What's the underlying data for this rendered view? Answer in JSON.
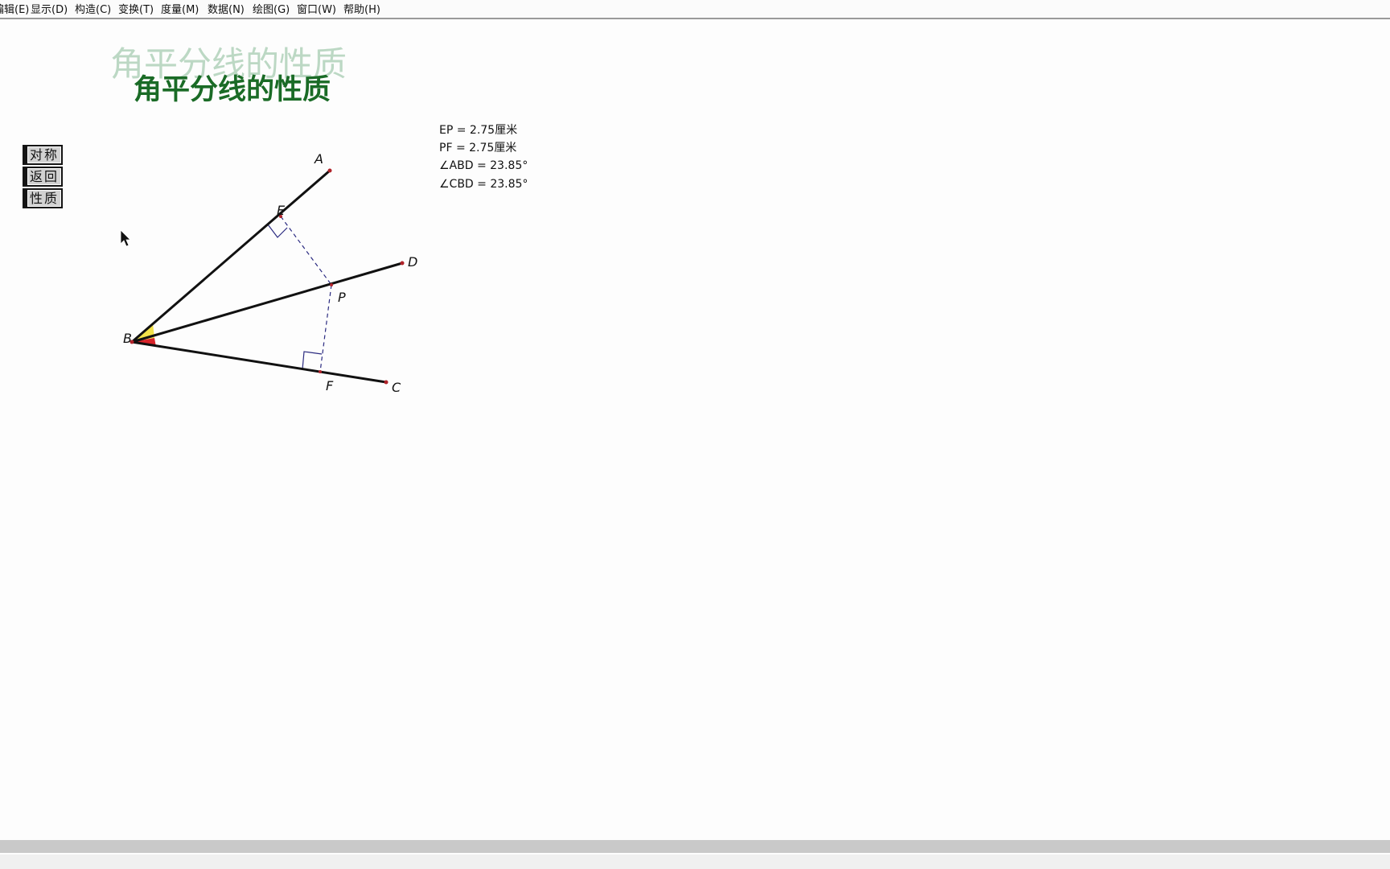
{
  "menu": [
    {
      "label": "编辑(E)"
    },
    {
      "label": "显示(D)"
    },
    {
      "label": "构造(C)"
    },
    {
      "label": "变换(T)"
    },
    {
      "label": "度量(M)"
    },
    {
      "label": "数据(N)"
    },
    {
      "label": "绘图(G)"
    },
    {
      "label": "窗口(W)"
    },
    {
      "label": "帮助(H)"
    }
  ],
  "title": {
    "ghost": "角平分线的性质",
    "main": "角平分线的性质"
  },
  "buttons": [
    {
      "label": "对称"
    },
    {
      "label": "返回"
    },
    {
      "label": "性质"
    }
  ],
  "measurements": [
    "EP = 2.75厘米",
    "PF = 2.75厘米",
    "∠ABD = 23.85°",
    "∠CBD = 23.85°"
  ],
  "points": {
    "A": "A",
    "B": "B",
    "C": "C",
    "D": "D",
    "E": "E",
    "F": "F",
    "P": "P"
  },
  "colors": {
    "title_main": "#1a6b26",
    "title_ghost": "#bcd8c4",
    "angle_abd": "#f2e24a",
    "angle_cbd": "#d8242a",
    "perpendicular": "#2a2a80"
  }
}
